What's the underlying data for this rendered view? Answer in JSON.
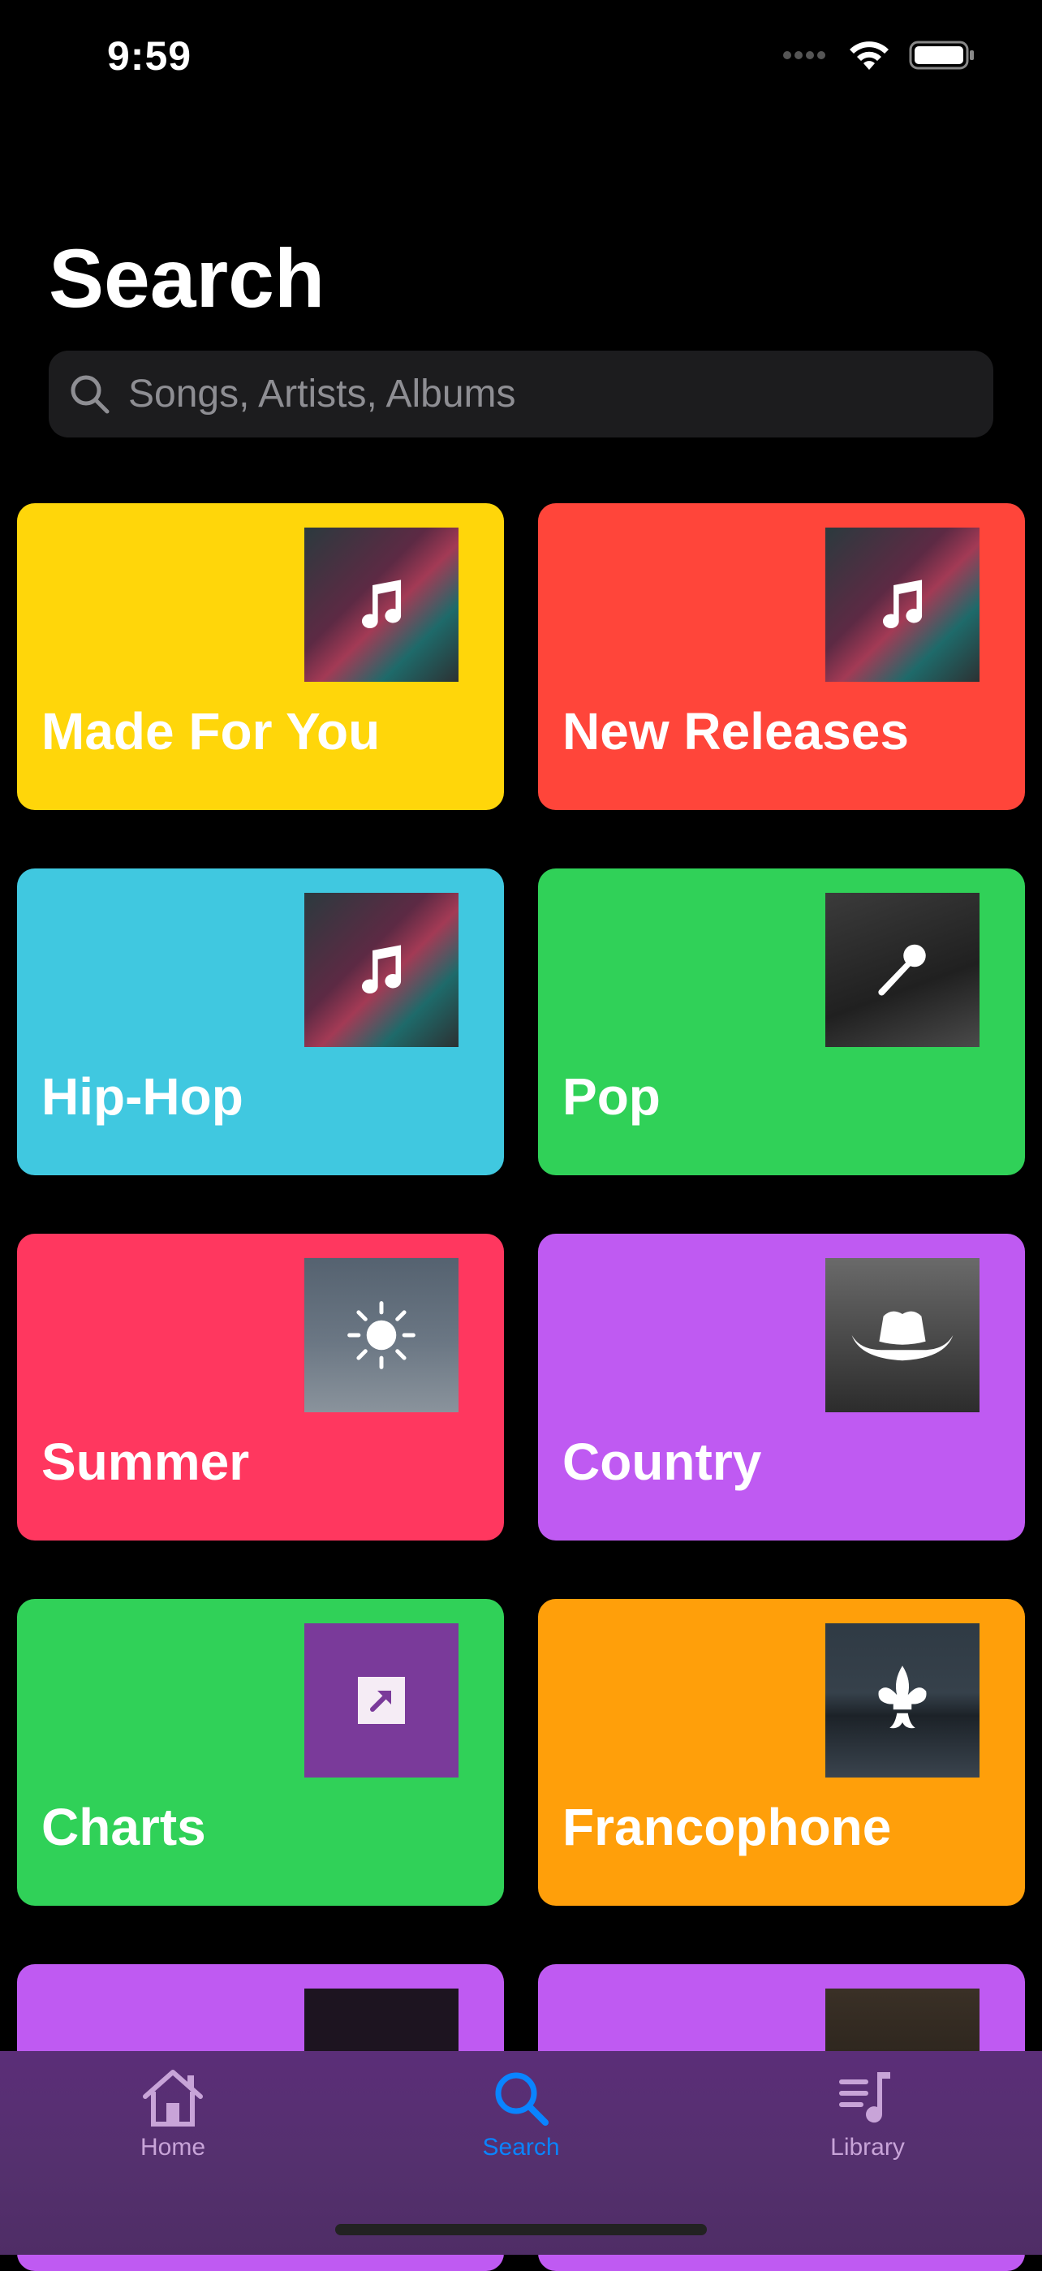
{
  "status_bar": {
    "time": "9:59"
  },
  "page": {
    "title": "Search"
  },
  "search": {
    "placeholder": "Songs, Artists, Albums"
  },
  "colors": {
    "yellow": "#ffd60a",
    "red": "#ff453a",
    "cyan": "#40c8e0",
    "green": "#30d158",
    "pink": "#ff375f",
    "purple": "#bf5af2",
    "orange": "#ff9f0a",
    "accent": "#0a84ff"
  },
  "categories": [
    {
      "label": "Made For You",
      "color": "#ffd60a",
      "icon": "music-note-icon"
    },
    {
      "label": "New Releases",
      "color": "#ff453a",
      "icon": "music-note-icon"
    },
    {
      "label": "Hip-Hop",
      "color": "#40c8e0",
      "icon": "music-note-icon"
    },
    {
      "label": "Pop",
      "color": "#30d158",
      "icon": "microphone-icon"
    },
    {
      "label": "Summer",
      "color": "#ff375f",
      "icon": "sun-icon"
    },
    {
      "label": "Country",
      "color": "#bf5af2",
      "icon": "cowboy-hat-icon"
    },
    {
      "label": "Charts",
      "color": "#30d158",
      "icon": "arrow-up-right-icon"
    },
    {
      "label": "Francophone",
      "color": "#ff9f0a",
      "icon": "fleur-de-lis-icon"
    },
    {
      "label": "",
      "color": "#bf5af2",
      "icon": "vinyl-icon"
    },
    {
      "label": "",
      "color": "#bf5af2",
      "icon": "amplifier-icon"
    }
  ],
  "tab_bar": {
    "items": [
      {
        "label": "Home",
        "icon": "house-icon",
        "active": false
      },
      {
        "label": "Search",
        "icon": "search-icon",
        "active": true
      },
      {
        "label": "Library",
        "icon": "music-library-icon",
        "active": false
      }
    ]
  }
}
